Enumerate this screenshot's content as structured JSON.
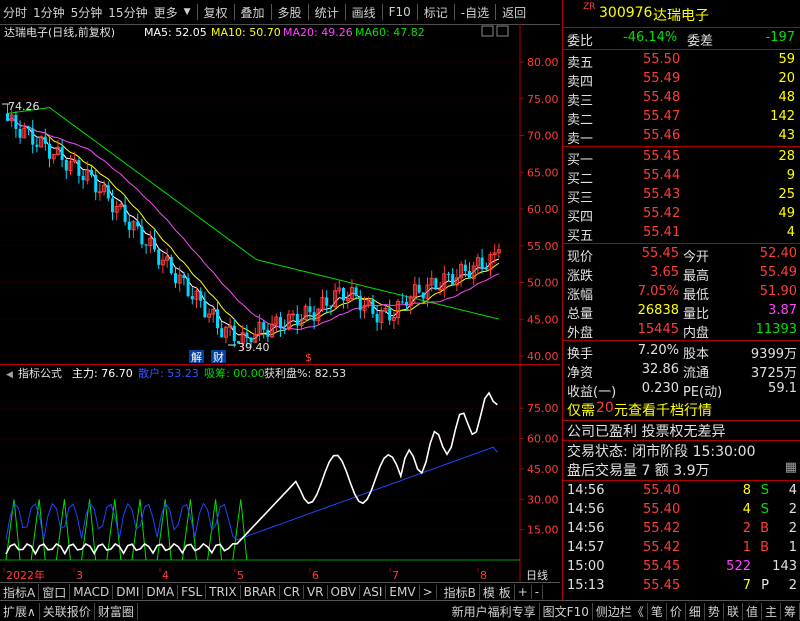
{
  "toolbar": {
    "items": [
      "分时",
      "1分钟",
      "5分钟",
      "15分钟",
      "更多",
      "复权",
      "叠加",
      "多股",
      "统计",
      "画线",
      "F10",
      "标记",
      "-自选",
      "返回"
    ]
  },
  "chart": {
    "title": "达瑞电子(日线,前复权)",
    "ma5_label": "MA5: 52.05",
    "ma10_label": "MA10: 50.70",
    "ma20_label": "MA20: 49.26",
    "ma60_label": "MA60: 47.82",
    "high_marker": "74.26",
    "low_marker": "39.40",
    "marker_jie": "解",
    "marker_cai": "财",
    "marker_dollar": "$",
    "yticks": [
      "80.00",
      "75.00",
      "70.00",
      "65.00",
      "60.00",
      "55.00",
      "50.00",
      "45.00",
      "40.00"
    ],
    "colors": {
      "ma5": "#ffffff",
      "ma10": "#ffff00",
      "ma20": "#ff44ff",
      "ma60": "#00e000",
      "up": "#ff3c3c",
      "down": "#00d8ff"
    }
  },
  "indicator": {
    "title": "指标公式",
    "main_label": "主力: 76.70",
    "retail_label": "散户: 53.23",
    "absorb_label": "吸筹: 00.00",
    "profit_label": "获利盘%: 82.53",
    "yticks": [
      "75.00",
      "60.00",
      "45.00",
      "30.00",
      "15.00"
    ]
  },
  "xaxis": {
    "labels": [
      "2022年",
      "3",
      "4",
      "5",
      "6",
      "7",
      "8"
    ],
    "period": "日线"
  },
  "bottombar": {
    "items": [
      "指标A",
      "窗口",
      "MACD",
      "DMI",
      "DMA",
      "FSL",
      "TRIX",
      "BRAR",
      "CR",
      "VR",
      "OBV",
      "ASI",
      "EMV",
      ">",
      "指标B",
      "模 板",
      "+",
      "-"
    ]
  },
  "statusbar": {
    "items": [
      "扩展∧",
      "关联报价",
      "财富圈"
    ],
    "right_items": [
      "新用户福利专享",
      "图文F10",
      "侧边栏《",
      "笔",
      "价",
      "细",
      "势",
      "联",
      "值",
      "主",
      "筹"
    ]
  },
  "quote": {
    "code_prefix": "ZR",
    "code": "300976",
    "name": "达瑞电子",
    "weibi_label": "委比",
    "weibi_value": "-46.14%",
    "weicha_label": "委差",
    "weicha_value": "-197",
    "sell": [
      {
        "label": "卖五",
        "price": "55.50",
        "vol": "59"
      },
      {
        "label": "卖四",
        "price": "55.49",
        "vol": "20"
      },
      {
        "label": "卖三",
        "price": "55.48",
        "vol": "48"
      },
      {
        "label": "卖二",
        "price": "55.47",
        "vol": "142"
      },
      {
        "label": "卖一",
        "price": "55.46",
        "vol": "43"
      }
    ],
    "buy": [
      {
        "label": "买一",
        "price": "55.45",
        "vol": "28"
      },
      {
        "label": "买二",
        "price": "55.44",
        "vol": "9"
      },
      {
        "label": "买三",
        "price": "55.43",
        "vol": "25"
      },
      {
        "label": "买四",
        "price": "55.42",
        "vol": "49"
      },
      {
        "label": "买五",
        "price": "55.41",
        "vol": "4"
      }
    ],
    "stats": [
      {
        "l1": "现价",
        "v1": "55.45",
        "c1": "red",
        "l2": "今开",
        "v2": "52.40",
        "c2": "red"
      },
      {
        "l1": "涨跌",
        "v1": "3.65",
        "c1": "red",
        "l2": "最高",
        "v2": "55.49",
        "c2": "red"
      },
      {
        "l1": "涨幅",
        "v1": "7.05%",
        "c1": "red",
        "l2": "最低",
        "v2": "51.90",
        "c2": "red"
      },
      {
        "l1": "总量",
        "v1": "26838",
        "c1": "yellow",
        "l2": "量比",
        "v2": "3.87",
        "c2": "magenta"
      },
      {
        "l1": "外盘",
        "v1": "15445",
        "c1": "red",
        "l2": "内盘",
        "v2": "11393",
        "c2": "green"
      }
    ],
    "stats2": [
      {
        "l1": "换手",
        "v1": "7.20%",
        "l2": "股本",
        "v2": "9399万"
      },
      {
        "l1": "净资",
        "v1": "32.86",
        "l2": "流通",
        "v2": "3725万"
      },
      {
        "l1": "收益(一)",
        "v1": "0.230",
        "l2": "PE(动)",
        "v2": "59.1"
      }
    ],
    "promo1_a": "仅需",
    "promo1_b": "20",
    "promo1_c": "元查看千档行情",
    "promo2": "公司已盈利 投票权无差异",
    "trade_state": "交易状态: 闭市阶段 15:30:00",
    "after_hours": "盘后交易量 7 额 3.9万",
    "ticks": [
      {
        "t": "14:56",
        "p": "55.40",
        "v": "8",
        "d": "S",
        "n": "4",
        "c": "yellow",
        "dc": "green"
      },
      {
        "t": "14:56",
        "p": "55.40",
        "v": "4",
        "d": "S",
        "n": "2",
        "c": "yellow",
        "dc": "green"
      },
      {
        "t": "14:56",
        "p": "55.42",
        "v": "2",
        "d": "B",
        "n": "2",
        "c": "red",
        "dc": "red"
      },
      {
        "t": "14:57",
        "p": "55.42",
        "v": "1",
        "d": "B",
        "n": "1",
        "c": "red",
        "dc": "red"
      },
      {
        "t": "15:00",
        "p": "55.45",
        "v": "522",
        "d": "",
        "n": "143",
        "c": "magenta",
        "dc": "white"
      },
      {
        "t": "15:13",
        "p": "55.45",
        "v": "7",
        "d": "P",
        "n": "2",
        "c": "yellow",
        "dc": "white"
      }
    ]
  }
}
